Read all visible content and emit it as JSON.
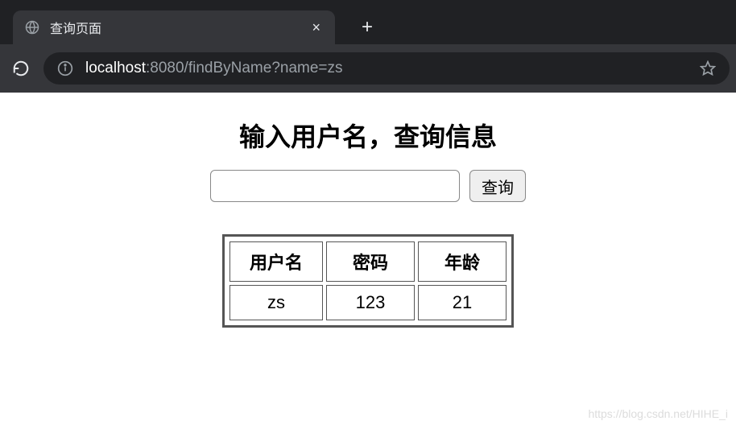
{
  "browser": {
    "tab_title": "查询页面",
    "url_host": "localhost",
    "url_rest": ":8080/findByName?name=zs"
  },
  "page": {
    "heading": "输入用户名，查询信息",
    "search_value": "",
    "search_button": "查询",
    "watermark": "https://blog.csdn.net/HIHE_i"
  },
  "table": {
    "headers": [
      "用户名",
      "密码",
      "年龄"
    ],
    "rows": [
      [
        "zs",
        "123",
        "21"
      ]
    ]
  }
}
